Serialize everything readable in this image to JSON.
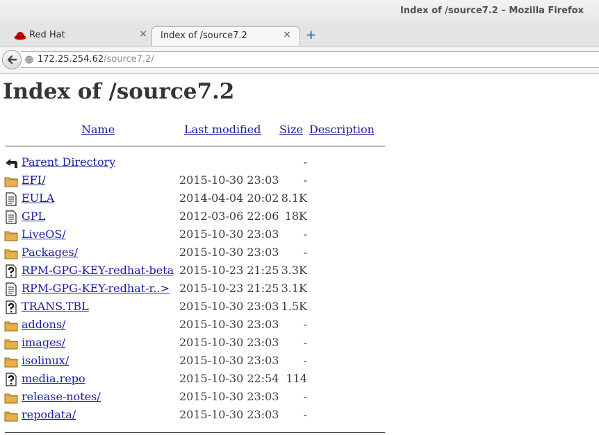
{
  "window": {
    "title": "Index of /source7.2 – Mozilla Firefox"
  },
  "tabs": [
    {
      "label": "Red Hat",
      "close": "×"
    },
    {
      "label": "Index of /source7.2",
      "close": "×"
    }
  ],
  "new_tab": "+",
  "address": {
    "host": "172.25.254.62",
    "path": "/source7.2/"
  },
  "page": {
    "title": "Index of /source7.2",
    "headers": {
      "name": "Name",
      "modified": "Last modified",
      "size": "Size",
      "description": "Description"
    },
    "rows": [
      {
        "name": "Parent Directory",
        "date": "",
        "size": "-",
        "icon": "back-icon"
      },
      {
        "name": "EFI/",
        "date": "2015-10-30 23:03",
        "size": "-",
        "icon": "folder-icon"
      },
      {
        "name": "EULA",
        "date": "2014-04-04 20:02",
        "size": "8.1K",
        "icon": "text-file-icon"
      },
      {
        "name": "GPL",
        "date": "2012-03-06 22:06",
        "size": "18K",
        "icon": "text-file-icon"
      },
      {
        "name": "LiveOS/",
        "date": "2015-10-30 23:03",
        "size": "-",
        "icon": "folder-icon"
      },
      {
        "name": "Packages/",
        "date": "2015-10-30 23:03",
        "size": "-",
        "icon": "folder-icon"
      },
      {
        "name": "RPM-GPG-KEY-redhat-beta",
        "date": "2015-10-23 21:25",
        "size": "3.3K",
        "icon": "unknown-file-icon"
      },
      {
        "name": "RPM-GPG-KEY-redhat-r..>",
        "date": "2015-10-23 21:25",
        "size": "3.1K",
        "icon": "text-file-icon"
      },
      {
        "name": "TRANS.TBL",
        "date": "2015-10-30 23:03",
        "size": "1.5K",
        "icon": "unknown-file-icon"
      },
      {
        "name": "addons/",
        "date": "2015-10-30 23:03",
        "size": "-",
        "icon": "folder-icon"
      },
      {
        "name": "images/",
        "date": "2015-10-30 23:03",
        "size": "-",
        "icon": "folder-icon"
      },
      {
        "name": "isolinux/",
        "date": "2015-10-30 23:03",
        "size": "-",
        "icon": "folder-icon"
      },
      {
        "name": "media.repo",
        "date": "2015-10-30 22:54",
        "size": "114",
        "icon": "unknown-file-icon"
      },
      {
        "name": "release-notes/",
        "date": "2015-10-30 23:03",
        "size": "-",
        "icon": "folder-icon"
      },
      {
        "name": "repodata/",
        "date": "2015-10-30 23:03",
        "size": "-",
        "icon": "folder-icon"
      }
    ]
  },
  "colors": {
    "link": "#1a1aa6",
    "folder": "#e8b04a",
    "new_tab": "#3d78c4"
  }
}
